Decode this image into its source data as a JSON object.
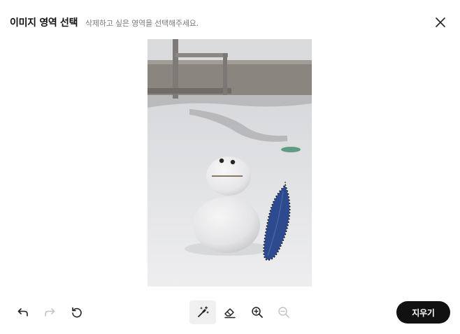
{
  "header": {
    "title": "이미지 영역 선택",
    "subtitle": "삭제하고 싶은 영역을 선택해주세요.",
    "close_icon": "close-icon"
  },
  "canvas": {
    "image_subject": "snowman-photo",
    "selection": "lasso-selection-on-blue-leaf"
  },
  "toolbar": {
    "history": [
      {
        "icon": "undo-icon",
        "enabled": true
      },
      {
        "icon": "redo-icon",
        "enabled": false
      },
      {
        "icon": "reset-icon",
        "enabled": true
      }
    ],
    "tools": [
      {
        "icon": "magic-wand-icon",
        "active": true
      },
      {
        "icon": "eraser-icon",
        "active": false
      },
      {
        "icon": "zoom-in-icon",
        "enabled": true
      },
      {
        "icon": "zoom-out-icon",
        "enabled": false
      }
    ],
    "erase_label": "지우기"
  },
  "colors": {
    "primary": "#111111",
    "disabled_icon": "#c4c4c4",
    "active_tool_bg": "#f0f0f0",
    "selection_fill": "#2e4a8f"
  }
}
